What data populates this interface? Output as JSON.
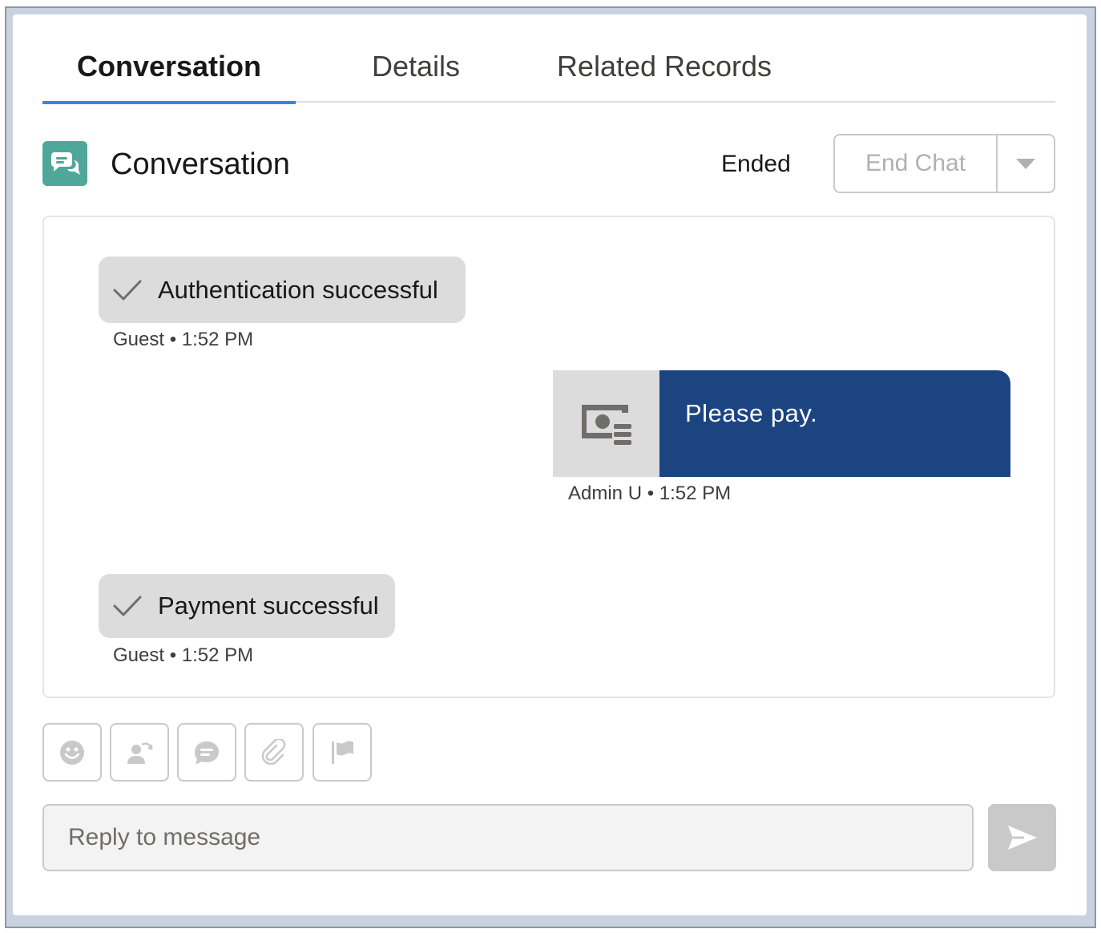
{
  "tabs": [
    {
      "label": "Conversation",
      "active": true
    },
    {
      "label": "Details",
      "active": false
    },
    {
      "label": "Related Records",
      "active": false
    }
  ],
  "header": {
    "icon": "chat-bubbles-icon",
    "title": "Conversation",
    "status": "Ended",
    "end_chat_label": "End Chat",
    "menu_icon": "chevron-down-icon"
  },
  "messages": [
    {
      "type": "event",
      "icon": "checkmark-icon",
      "text": "Authentication successful",
      "sender": "Guest",
      "time": "1:52 PM"
    },
    {
      "type": "outbound",
      "icon": "payment-icon",
      "text": "Please pay.",
      "sender": "Admin U",
      "time": "1:52 PM"
    },
    {
      "type": "event",
      "icon": "checkmark-icon",
      "text": "Payment successful",
      "sender": "Guest",
      "time": "1:52 PM"
    }
  ],
  "toolbar": [
    {
      "icon": "emoji-icon"
    },
    {
      "icon": "transfer-icon"
    },
    {
      "icon": "quick-text-icon"
    },
    {
      "icon": "attachment-icon"
    },
    {
      "icon": "flag-icon"
    }
  ],
  "reply": {
    "placeholder": "Reply to message",
    "value": ""
  },
  "send_icon": "send-icon",
  "colors": {
    "accent": "#3b82e6",
    "header_icon_bg": "#4fa79a",
    "outbound_bg": "#1b4481",
    "event_bg": "#dcdcdc"
  }
}
